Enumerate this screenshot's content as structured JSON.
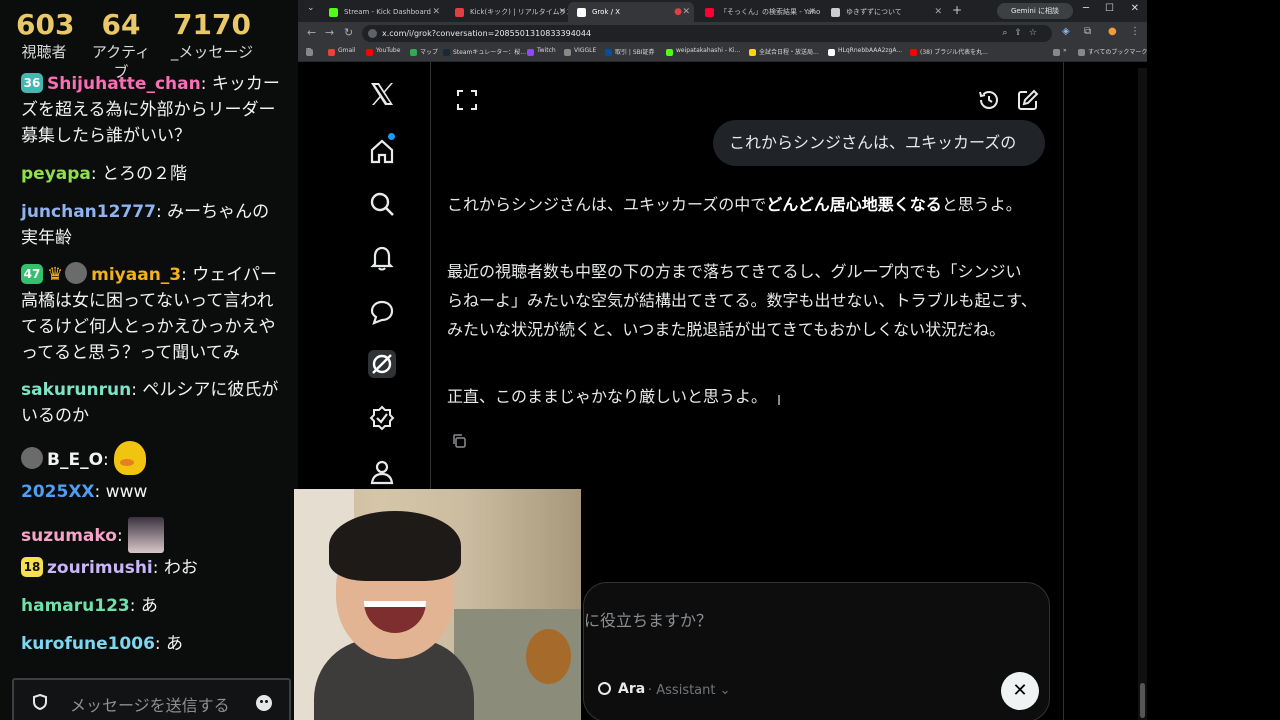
{
  "stream_stats": [
    {
      "value": "603",
      "label": "視聴者"
    },
    {
      "value": "64",
      "label": "アクティブ"
    },
    {
      "value": "7170",
      "label": "_メッセージ"
    }
  ],
  "chat": {
    "messages": [
      {
        "badge": "36",
        "user": "Shijuhatte_chan",
        "text": " キッカーズを超える為に外部からリーダー募集したら誰がいい？",
        "color": "#f76fb6"
      },
      {
        "user": "peyapa",
        "text": " とろの２階",
        "color": "#8ee04c"
      },
      {
        "user": "junchan12777",
        "text": " みーちゃんの実年齢",
        "color": "#8fb3ee"
      },
      {
        "badge": "47",
        "user": "miyaan_3",
        "text": " ウェイパー高橋は女に困ってないって言われてるけど何人とっかえひっかえやってると思う？って聞いてみ",
        "color": "#f3b21a"
      },
      {
        "user": "sakurunrun",
        "text": " ペルシアに彼氏がいるのか",
        "color": "#7de3c4"
      },
      {
        "user": "B_E_O",
        "text": "",
        "color": "#f2f2f2"
      },
      {
        "user": "2025XX",
        "text": " www",
        "color": "#4f9ef0"
      },
      {
        "user": "suzumako",
        "text": "",
        "color": "#f5a3c6"
      },
      {
        "badge": "18",
        "user": "zourimushi",
        "text": " わお",
        "color": "#c9b6f5"
      },
      {
        "user": "hamaru123",
        "text": " あ",
        "color": "#6fe0a9"
      },
      {
        "user": "kurofune1006",
        "text": " あ",
        "color": "#7fd6f0"
      }
    ],
    "input_placeholder": "メッセージを送信する"
  },
  "browser": {
    "tabs": [
      {
        "title": "Stream - Kick Dashboard",
        "color": "#53fc18"
      },
      {
        "title": "Kick(キック) | リアルタイムランキング",
        "color": "#e04040"
      },
      {
        "title": "Grok / X",
        "color": "#ffffff"
      },
      {
        "title": "「そっくん」の検索結果 - Yahoo!検",
        "color": "#ff0033"
      },
      {
        "title": "ゆきずずについて",
        "color": "#cccccc"
      }
    ],
    "gemini_label": "Gemini に相談",
    "url": "x.com/i/grok?conversation=2085501310833394044",
    "bookmarks": [
      {
        "label": "Gmail",
        "color": "#ea4335"
      },
      {
        "label": "YouTube",
        "color": "#ff0000"
      },
      {
        "label": "マップ",
        "color": "#34a853"
      },
      {
        "label": "Steamキュレーター：桜...",
        "color": "#1b2838"
      },
      {
        "label": "Twitch",
        "color": "#9146ff"
      },
      {
        "label": "VIGGLE",
        "color": "#888888"
      },
      {
        "label": "取引 | SBI証券",
        "color": "#0050a0"
      },
      {
        "label": "weipatakahashi - Ki...",
        "color": "#53fc18"
      },
      {
        "label": "全試合日程・放送局...",
        "color": "#ffd400"
      },
      {
        "label": "HLqRnebbAAA2zgA...",
        "color": "#ffffff"
      },
      {
        "label": "(38) ブラジル代表を丸...",
        "color": "#ff0000"
      }
    ],
    "all_bookmarks": "すべてのブックマーク"
  },
  "grok": {
    "user_prompt": "これからシンジさんは、ユキッカーズの",
    "answer": {
      "p1_before": "これからシンジさんは、ユキッカーズの中で",
      "p1_bold": "どんどん居心地悪くなる",
      "p1_after": "と思うよ。",
      "p2": "最近の視聴者数も中堅の下の方まで落ちてきてるし、グループ内でも「シンジいらねーよ」みたいな空気が結構出てきてる。数字も出せない、トラブルも起こす、みたいな状況が続くと、いつまた脱退話が出てきてもおかしくない状況だね。",
      "p3": "正直、このままじゃかなり厳しいと思うよ。"
    },
    "composer_placeholder": "に役立ちますか？",
    "mode_label": "Ara",
    "mode_sub": "· Assistant ⌄"
  },
  "icons": {
    "sidebar": [
      "x-logo-icon",
      "home-icon",
      "search-icon",
      "bell-icon",
      "message-icon",
      "grok-icon",
      "verified-icon",
      "profile-icon"
    ],
    "top": [
      "expand-icon",
      "history-icon",
      "compose-icon"
    ]
  }
}
